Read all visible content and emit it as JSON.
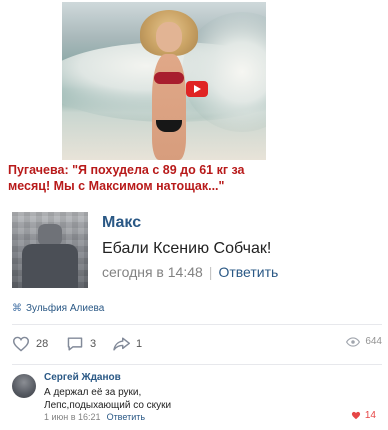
{
  "ad": {
    "caption": "Пугачева: \"Я похудела с 89 до 61 кг за месяц! Мы с Максимом натощак...\""
  },
  "post": {
    "author": "Макс",
    "message": "Ебали Ксению Собчак!",
    "time": "сегодня в 14:48",
    "reply_label": "Ответить"
  },
  "attachment": {
    "label": "Зульфия Алиева"
  },
  "actions": {
    "likes": "28",
    "comments": "3",
    "shares": "1",
    "views": "644"
  },
  "comment": {
    "author": "Сергей Жданов",
    "line1": "А держал её за руки,",
    "line2": "Лепс,подыхающий со скуки",
    "time": "1 июн в 16:21",
    "reply_label": "Ответить",
    "likes": "14"
  },
  "colors": {
    "link": "#2a5885",
    "ad_caption": "#b81a1a",
    "like_active": "#e64646"
  }
}
